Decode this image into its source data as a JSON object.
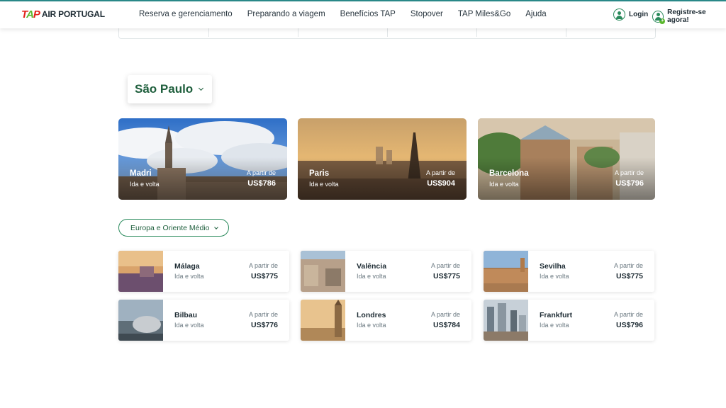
{
  "header": {
    "brand": "AIR PORTUGAL",
    "nav": [
      "Reserva e gerenciamento",
      "Preparando a viagem",
      "Benefícios TAP",
      "Stopover",
      "TAP Miles&Go",
      "Ajuda"
    ],
    "login": "Login",
    "register": "Registre-se agora!"
  },
  "origin": {
    "city": "São Paulo"
  },
  "featured": [
    {
      "city": "Madri",
      "trip": "Ida e volta",
      "from": "A partir de",
      "price": "US$786"
    },
    {
      "city": "Paris",
      "trip": "Ida e volta",
      "from": "A partir de",
      "price": "US$904"
    },
    {
      "city": "Barcelona",
      "trip": "Ida e volta",
      "from": "A partir de",
      "price": "US$796"
    }
  ],
  "region": {
    "label": "Europa e Oriente Médio"
  },
  "destinations": [
    {
      "city": "Málaga",
      "trip": "Ida e volta",
      "from": "A partir de",
      "price": "US$775"
    },
    {
      "city": "Valência",
      "trip": "Ida e volta",
      "from": "A partir de",
      "price": "US$775"
    },
    {
      "city": "Sevilha",
      "trip": "Ida e volta",
      "from": "A partir de",
      "price": "US$775"
    },
    {
      "city": "Bilbau",
      "trip": "Ida e volta",
      "from": "A partir de",
      "price": "US$776"
    },
    {
      "city": "Londres",
      "trip": "Ida e volta",
      "from": "A partir de",
      "price": "US$784"
    },
    {
      "city": "Frankfurt",
      "trip": "Ida e volta",
      "from": "A partir de",
      "price": "US$796"
    }
  ],
  "colors": {
    "brand_green": "#1f5f3d",
    "accent_green": "#5bb82e",
    "logo_red": "#e2231a"
  }
}
